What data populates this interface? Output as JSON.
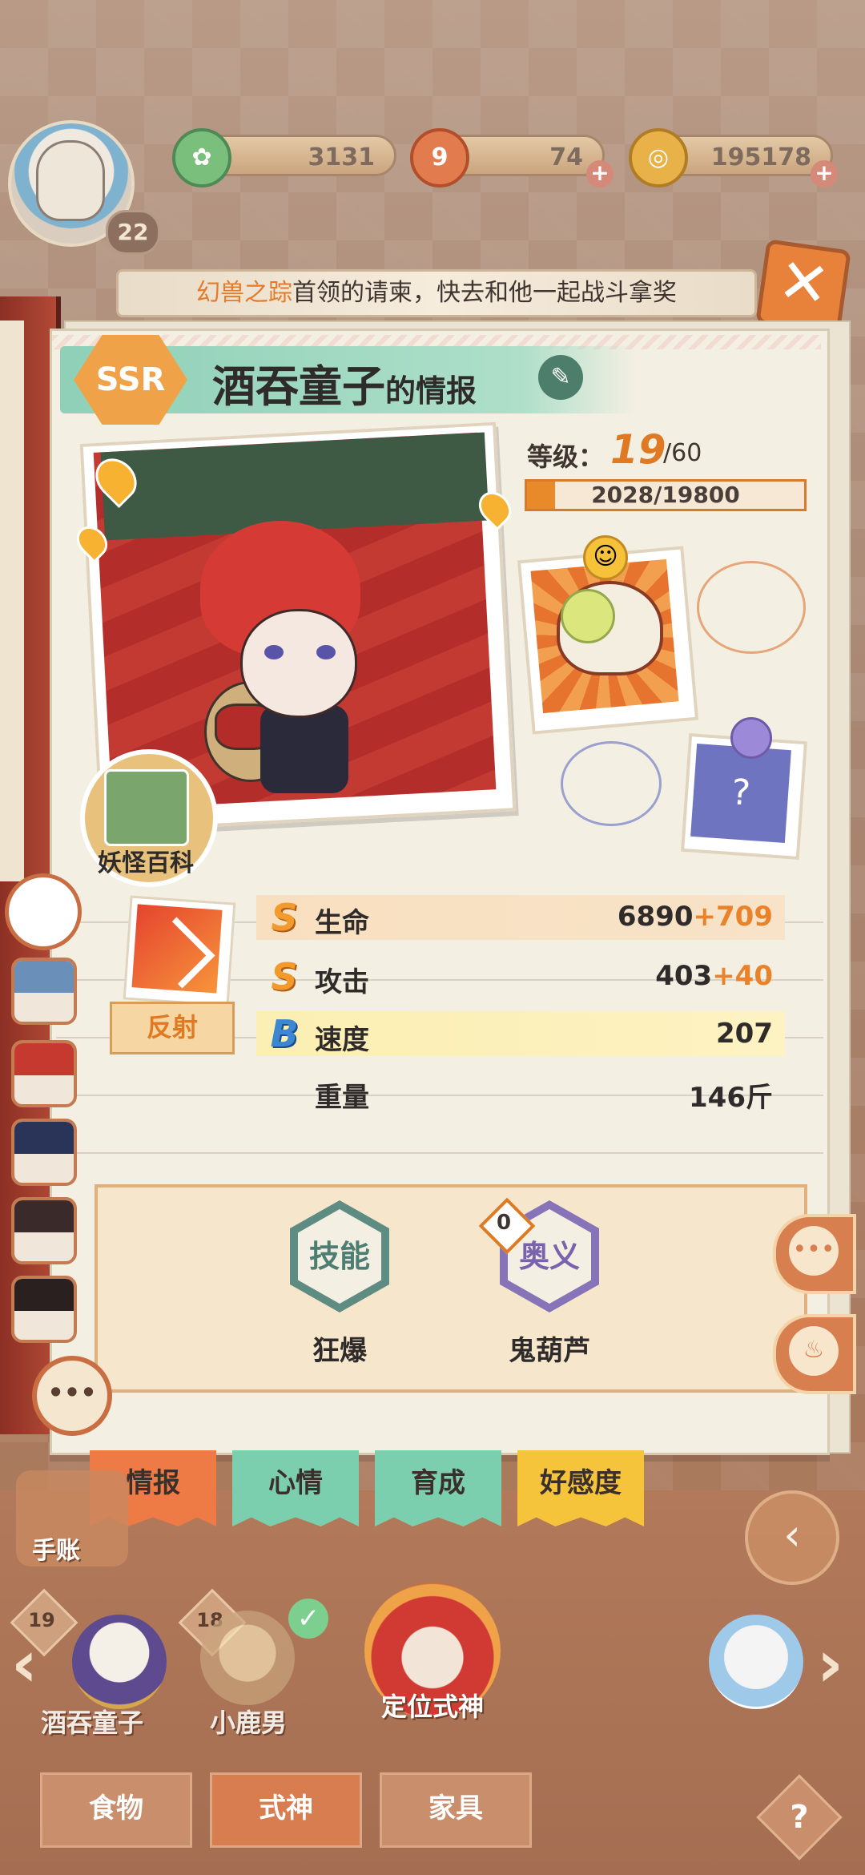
{
  "header": {
    "player_level": "22",
    "resources": [
      {
        "name": "jade",
        "value": "3131",
        "icon": "jade-icon"
      },
      {
        "name": "stamina",
        "value": "74",
        "icon": "stamina-icon"
      },
      {
        "name": "coins",
        "value": "195178",
        "icon": "coin-icon"
      }
    ]
  },
  "notice": {
    "highlight": "幻兽之踪",
    "text": "首领的请柬，快去和他一起战斗拿奖"
  },
  "card": {
    "rarity": "SSR",
    "name": "酒吞童子",
    "name_suffix": "的情报",
    "bestiary_label": "妖怪百科",
    "level_label": "等级：",
    "level": "19",
    "level_max": "/60",
    "exp_text": "2028/19800",
    "exp_fraction": 0.1024,
    "skill_passive_label": "反射",
    "stats": [
      {
        "grade": "S",
        "name": "生命",
        "base": "6890",
        "bonus": "+709"
      },
      {
        "grade": "S",
        "name": "攻击",
        "base": "403",
        "bonus": "+40"
      },
      {
        "grade": "B",
        "name": "速度",
        "base": "207",
        "bonus": ""
      },
      {
        "grade": "",
        "name": "重量",
        "base": "146斤",
        "bonus": ""
      }
    ],
    "skills": [
      {
        "type": "技能",
        "name": "狂爆"
      },
      {
        "type": "奥义",
        "name": "鬼葫芦",
        "count": "0"
      }
    ]
  },
  "tabs": [
    "情报",
    "心情",
    "育成",
    "好感度"
  ],
  "bottom": {
    "notebook_label": "手账",
    "roster": [
      {
        "name": "酒吞童子",
        "level": "19"
      },
      {
        "name": "小鹿男",
        "level": "18"
      },
      {
        "name": "定位式神",
        "level": ""
      }
    ],
    "categories": [
      "食物",
      "式神",
      "家具"
    ],
    "help": "?"
  },
  "colors": {
    "accent_orange": "#e07a22",
    "tab_info": "#ee7a45",
    "tab_mood": "#7ccfae",
    "tab_train": "#7ccfae",
    "tab_affinity": "#f5c43a"
  }
}
